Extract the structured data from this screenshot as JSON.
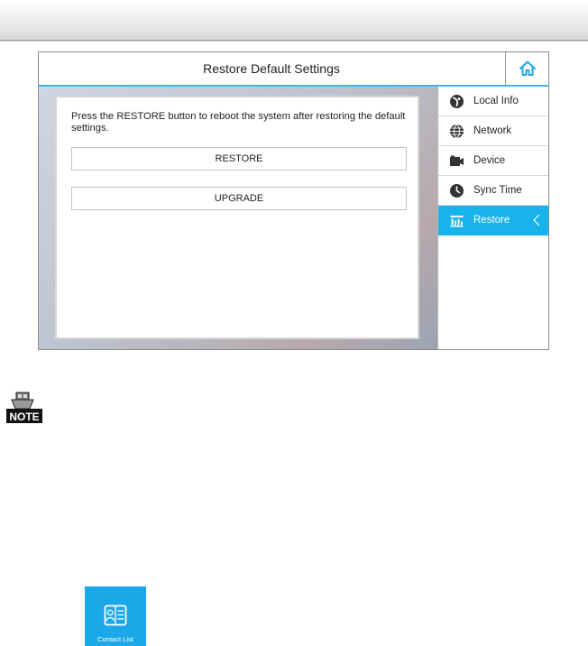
{
  "screen": {
    "title": "Restore Default Settings",
    "description": "Press the RESTORE button to reboot the system after restoring the default settings.",
    "buttons": {
      "restore": "RESTORE",
      "upgrade": "UPGRADE"
    },
    "sidebar": {
      "items": [
        {
          "label": "Local Info",
          "icon": "local-info-icon"
        },
        {
          "label": "Network",
          "icon": "globe-icon"
        },
        {
          "label": "Device",
          "icon": "camera-device-icon"
        },
        {
          "label": "Sync Time",
          "icon": "clock-icon"
        },
        {
          "label": "Restore",
          "icon": "restore-icon",
          "active": true
        }
      ]
    },
    "accent_color": "#17b3ea"
  },
  "note": {
    "icon_text": "NOTE"
  },
  "contact_tile": {
    "label": "Contact List",
    "color": "#1aa8e8"
  }
}
